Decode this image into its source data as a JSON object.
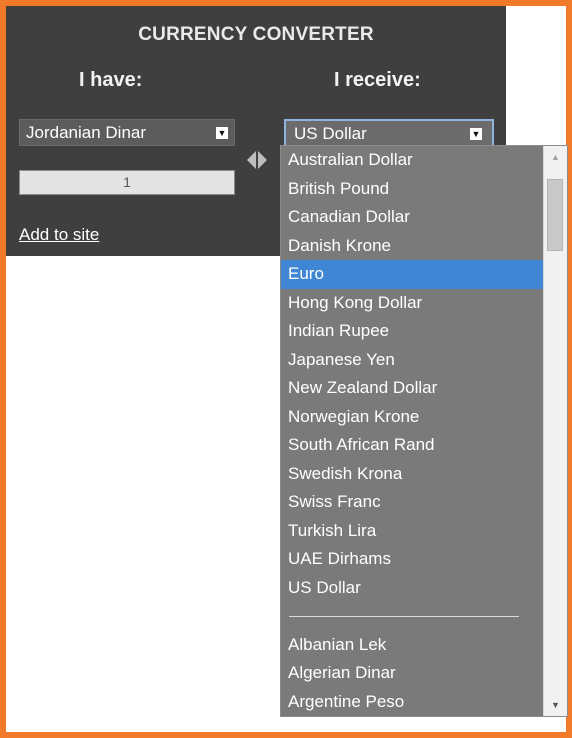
{
  "converter": {
    "title": "CURRENCY CONVERTER",
    "have_label": "I have:",
    "receive_label": "I receive:",
    "from_currency": "Jordanian Dinar",
    "to_currency": "US Dollar",
    "amount": "1",
    "add_link": "Add to site"
  },
  "icons": {
    "select_arrow": "▼",
    "swap": "swap-arrows-icon",
    "scroll_up": "▲",
    "scroll_down": "▼"
  },
  "dropdown": {
    "selected_index": 4,
    "options": [
      "Australian Dollar",
      "British Pound",
      "Canadian Dollar",
      "Danish Krone",
      "Euro",
      "Hong Kong Dollar",
      "Indian Rupee",
      "Japanese Yen",
      "New Zealand Dollar",
      "Norwegian Krone",
      "South African Rand",
      "Swedish Krona",
      "Swiss Franc",
      "Turkish Lira",
      "UAE Dirhams",
      "US Dollar"
    ],
    "options_more": [
      "Albanian Lek",
      "Algerian Dinar",
      "Argentine Peso"
    ]
  },
  "colors": {
    "frame": "#f07a2a",
    "panel": "#3f3f3f",
    "highlight": "#3f86d4"
  }
}
